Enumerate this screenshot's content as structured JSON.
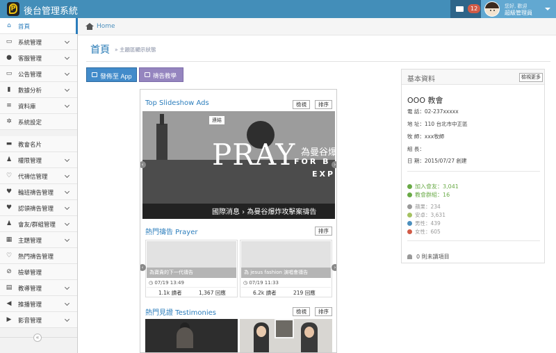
{
  "app": {
    "title": "後台管理系統"
  },
  "topbar": {
    "mail_count": "12",
    "user_greeting": "您好, 歡迎",
    "user_role": "超級管理員"
  },
  "sidebar": {
    "items": [
      {
        "label": "首頁",
        "icon": "home-icon",
        "active": true
      },
      {
        "label": "系統管理",
        "icon": "desktop-icon"
      },
      {
        "label": "客服管理",
        "icon": "chat-icon"
      },
      {
        "label": "公告管理",
        "icon": "laptop-icon"
      },
      {
        "label": "數據分析",
        "icon": "bar-chart-icon"
      },
      {
        "label": "資料庫",
        "icon": "database-icon"
      },
      {
        "label": "系統設定",
        "icon": "gears-icon"
      },
      {
        "label": "教會名片",
        "icon": "card-icon"
      },
      {
        "label": "權限管理",
        "icon": "user-icon"
      },
      {
        "label": "代禱信管理",
        "icon": "heart-icon"
      },
      {
        "label": "輪班禱告管理",
        "icon": "heartbeat-icon"
      },
      {
        "label": "認領禱告管理",
        "icon": "hand-heart-icon"
      },
      {
        "label": "會友/群組管理",
        "icon": "users-icon"
      },
      {
        "label": "主題管理",
        "icon": "grid-icon"
      },
      {
        "label": "熱門禱告管理",
        "icon": "heart-outline-icon"
      },
      {
        "label": "檢舉管理",
        "icon": "ban-icon"
      },
      {
        "label": "教導管理",
        "icon": "book-icon"
      },
      {
        "label": "推播管理",
        "icon": "bullhorn-icon"
      },
      {
        "label": "影音管理",
        "icon": "play-icon"
      }
    ]
  },
  "breadcrumb": {
    "home": "Home"
  },
  "page": {
    "title": "首頁",
    "subtitle": "» 主題區顯示狀態",
    "publish_btn": "發佈至 App",
    "tutorial_btn": "禱告教學"
  },
  "phone": {
    "view_label": "檢視",
    "sort_label": "排序",
    "slideshow": {
      "title": "Top Slideshow Ads",
      "tag": "連結",
      "headline": "PRAY",
      "overlay_cn": "為曼谷爆",
      "overlay_sub1": "FOR B",
      "overlay_sub2": "EXPL",
      "caption": "國際消息 › 為曼谷爆炸攻擊案禱告"
    },
    "prayer": {
      "title": "熱門禱告 Prayer",
      "cards": [
        {
          "caption": "為寶貴的下一代禱告",
          "date": "07/19 13:49",
          "views": "1.1k 讀者",
          "ads": "1,367 回應"
        },
        {
          "caption": "為 jesus fashion 演唱會禱告",
          "date": "07/19 11:33",
          "views": "6.2k 讀者",
          "ads": "219 回應"
        }
      ]
    },
    "testimonies": {
      "title": "熱門見證 Testimonies"
    }
  },
  "info": {
    "title": "基本資料",
    "more_btn": "檢視更多",
    "church_name": "OOO 教會",
    "phone": "電 話：02-237xxxxx",
    "address": "地 址：110 台北市中正區",
    "pastor": "牧 師：xxx牧師",
    "elder": "組 長：",
    "date": "日 期：2015/07/27 創建",
    "members": "加入會友：3,041",
    "groups": "教會群組：16",
    "apple": "蘋果：234",
    "android": "安卓：3,631",
    "male": "男性：439",
    "female": "女性：605",
    "unread": "0 則未讀項目"
  },
  "colors": {
    "navbar": "#438eb9",
    "accent": "#2b7dbc",
    "publish": "#428bca",
    "tutorial": "#9585bf",
    "badge": "#d15b47",
    "stat_green": "#69aa46"
  }
}
